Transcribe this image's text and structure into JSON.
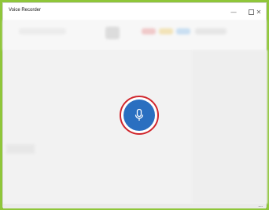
{
  "window": {
    "title": "Voice Recorder",
    "minimize_label": "—",
    "close_label": "✕"
  },
  "record": {
    "icon": "microphone-icon",
    "accent": "#2a6fc0",
    "highlight": "#d0262c"
  },
  "bottom": {
    "more_label": "..."
  }
}
